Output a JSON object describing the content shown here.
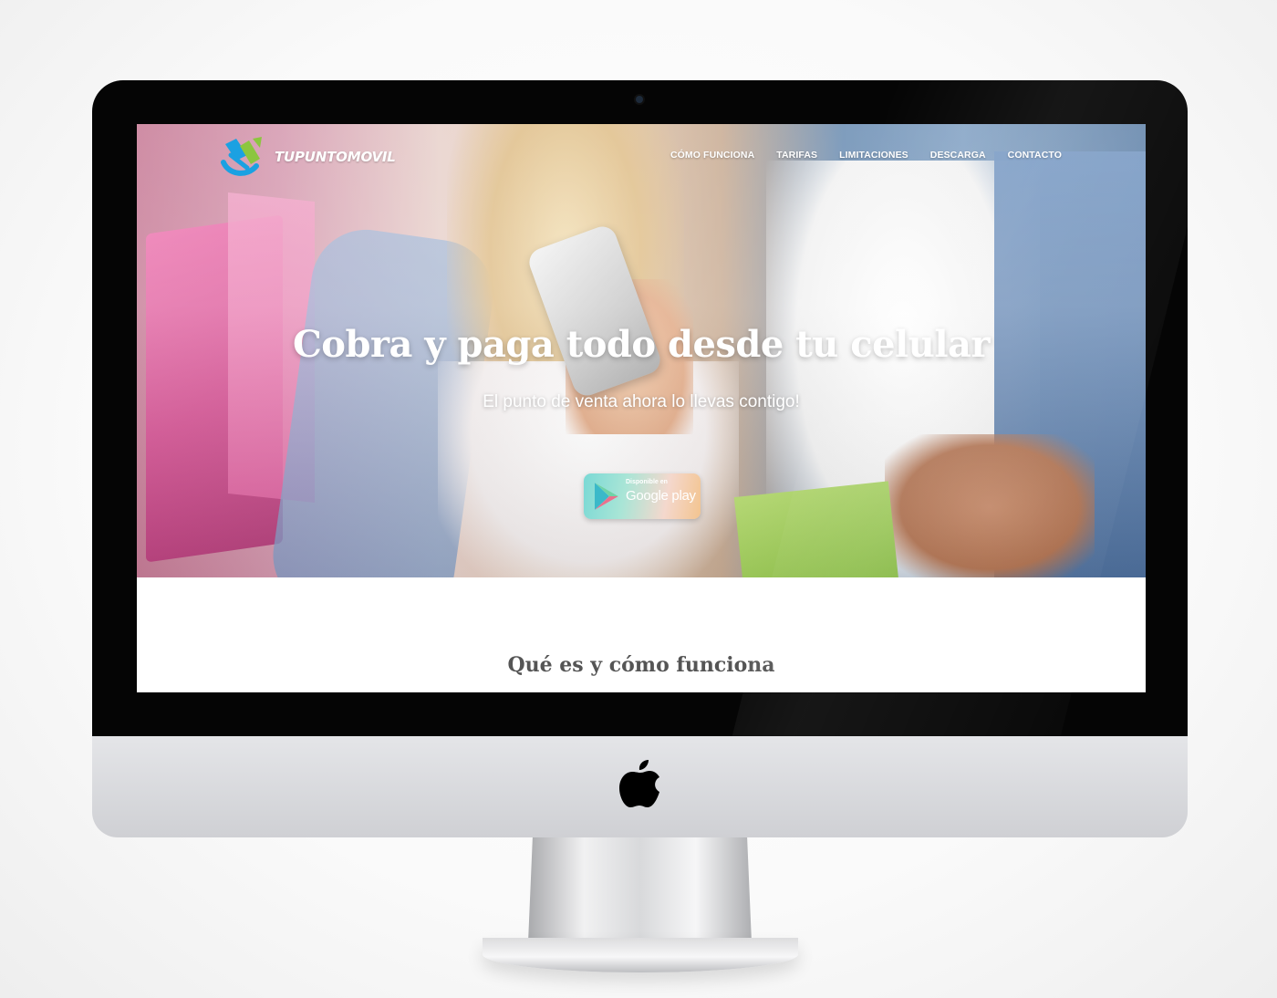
{
  "site": {
    "logo_text": "TUPUNTOMOVIL",
    "brand_colors": {
      "green": "#8cc63f",
      "blue": "#1ba1e2"
    }
  },
  "nav": {
    "items": [
      {
        "label": "CÓMO FUNCIONA"
      },
      {
        "label": "TARIFAS"
      },
      {
        "label": "LIMITACIONES"
      },
      {
        "label": "DESCARGA"
      },
      {
        "label": "CONTACTO"
      }
    ]
  },
  "hero": {
    "title": "Cobra y paga todo desde tu celular",
    "subtitle": "El punto de venta ahora lo llevas contigo!",
    "store_badge": {
      "small_text": "Disponible en",
      "store_name": "Google play",
      "icon": "google-play-icon"
    }
  },
  "section": {
    "title": "Qué es y cómo funciona"
  },
  "device": {
    "icon": "apple-logo-icon"
  }
}
